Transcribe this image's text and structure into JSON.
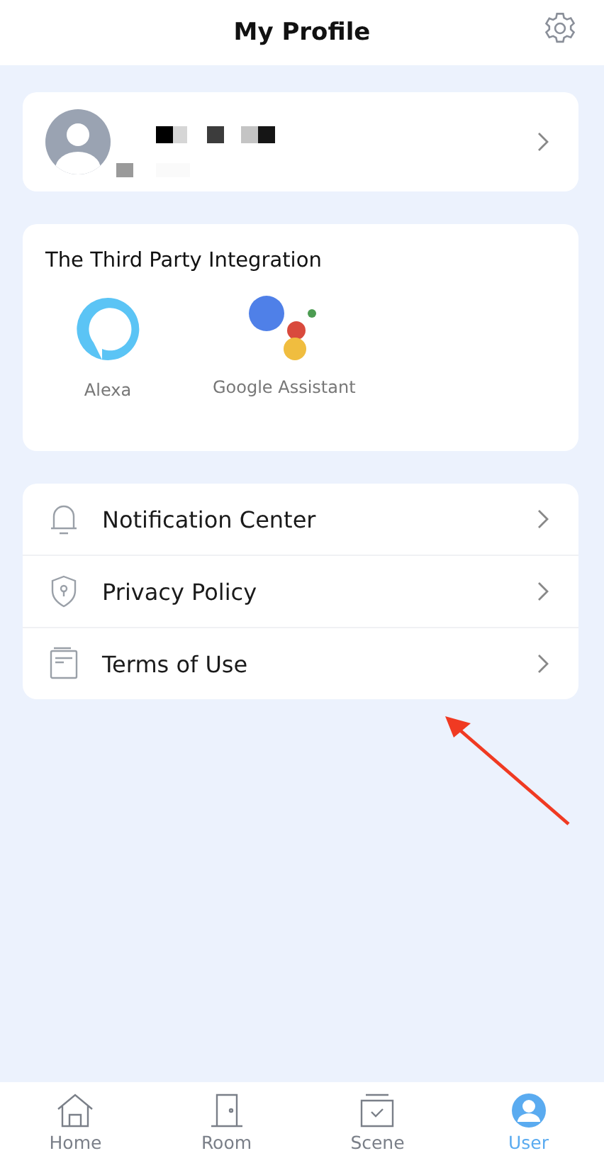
{
  "header": {
    "title": "My Profile"
  },
  "integration": {
    "title": "The Third Party Integration",
    "items": [
      {
        "kind": "alexa",
        "label": "Alexa"
      },
      {
        "kind": "google",
        "label": "Google Assistant"
      }
    ]
  },
  "menu": [
    {
      "kind": "bell",
      "label": "Notification Center"
    },
    {
      "kind": "shield",
      "label": "Privacy Policy"
    },
    {
      "kind": "document",
      "label": "Terms of Use"
    }
  ],
  "tabs": [
    {
      "kind": "home",
      "label": "Home",
      "selected": false
    },
    {
      "kind": "room",
      "label": "Room",
      "selected": false
    },
    {
      "kind": "scene",
      "label": "Scene",
      "selected": false
    },
    {
      "kind": "user",
      "label": "User",
      "selected": true
    }
  ]
}
